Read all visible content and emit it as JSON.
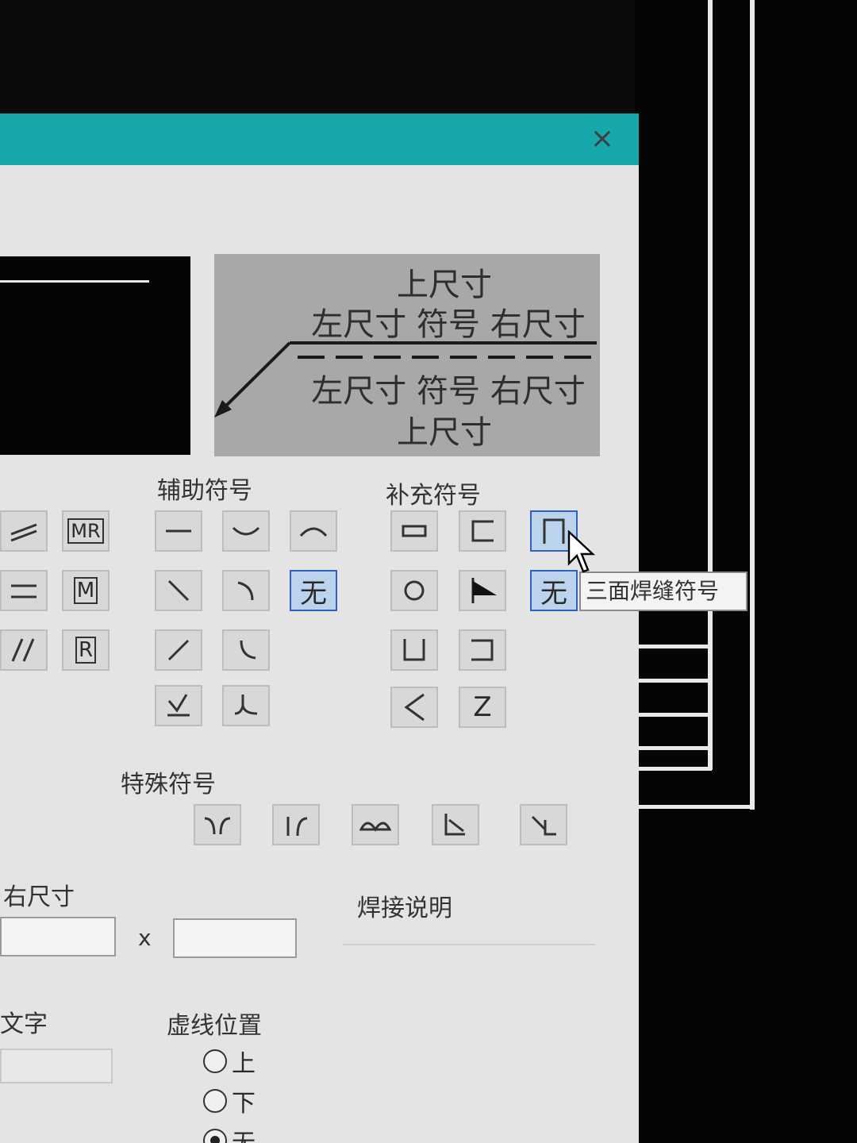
{
  "dialog": {
    "close_glyph": "×"
  },
  "preview_legend": {
    "top": "上尺寸",
    "row_above": "左尺寸 符号 右尺寸",
    "row_below": "左尺寸 符号 右尺寸",
    "bottom": "上尺寸"
  },
  "groups": {
    "auxiliary_label": "辅助符号",
    "supplementary_label": "补充符号",
    "special_label": "特殊符号"
  },
  "left_symbols": {
    "mr": "MR",
    "m": "M",
    "r": "R"
  },
  "auxiliary_symbols": {
    "none": "无"
  },
  "supplementary_symbols": {
    "none": "无",
    "z": "Z"
  },
  "tooltip": "三面焊缝符号",
  "dimensions": {
    "right_label": "右尺寸",
    "x_sep": "x"
  },
  "weld_note_label": "焊接说明",
  "text_label": "文字",
  "dash_position": {
    "label": "虚线位置",
    "options": [
      "上",
      "下",
      "无"
    ],
    "selected": "无"
  },
  "colors": {
    "titlebar": "#18a8ab",
    "selected": "#2f63c0"
  }
}
